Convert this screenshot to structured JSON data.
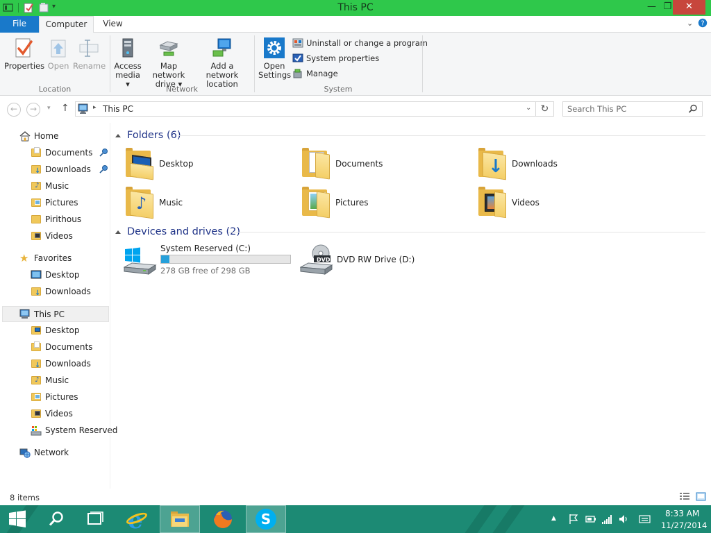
{
  "window": {
    "title": "This PC",
    "controls": {
      "minimize": "—",
      "maximize": "❐",
      "close": "✕"
    }
  },
  "ribbon_tabs": [
    {
      "label": "File"
    },
    {
      "label": "Computer"
    },
    {
      "label": "View"
    }
  ],
  "ribbon": {
    "location": {
      "label": "Location",
      "properties": "Properties",
      "open": "Open",
      "rename": "Rename"
    },
    "network": {
      "label": "Network",
      "access_media_1": "Access",
      "access_media_2": "media ▾",
      "map_drive_1": "Map network",
      "map_drive_2": "drive ▾",
      "add_location_1": "Add a network",
      "add_location_2": "location"
    },
    "system": {
      "label": "System",
      "open_settings_1": "Open",
      "open_settings_2": "Settings",
      "uninstall": "Uninstall or change a program",
      "system_properties": "System properties",
      "manage": "Manage"
    }
  },
  "address": {
    "path": "This PC",
    "search_placeholder": "Search This PC"
  },
  "nav_pane": {
    "home": "Home",
    "home_items": [
      "Documents",
      "Downloads",
      "Music",
      "Pictures",
      "Pirithous",
      "Videos"
    ],
    "favorites": "Favorites",
    "favorites_items": [
      "Desktop",
      "Downloads"
    ],
    "this_pc": "This PC",
    "this_pc_items": [
      "Desktop",
      "Documents",
      "Downloads",
      "Music",
      "Pictures",
      "Videos",
      "System Reserved"
    ],
    "network": "Network"
  },
  "content": {
    "folders_header": "Folders (6)",
    "folders": [
      "Desktop",
      "Documents",
      "Downloads",
      "Music",
      "Pictures",
      "Videos"
    ],
    "drives_header": "Devices and drives (2)",
    "drives": [
      {
        "name": "System Reserved (C:)",
        "free": "278 GB free of 298 GB",
        "used_fraction": 0.067
      },
      {
        "name": "DVD RW Drive (D:)",
        "badge": "DVD"
      }
    ]
  },
  "status": {
    "item_count": "8 items"
  },
  "taskbar": {
    "time": "8:33 AM",
    "date": "11/27/2014",
    "skype_letter": "S",
    "ie_letter": "e"
  },
  "colors": {
    "titlebar": "#2fc84b",
    "accent_blue": "#1979ca",
    "taskbar": "#1c8a74",
    "group_header": "#1e3287",
    "drive_fill": "#26a0da"
  }
}
